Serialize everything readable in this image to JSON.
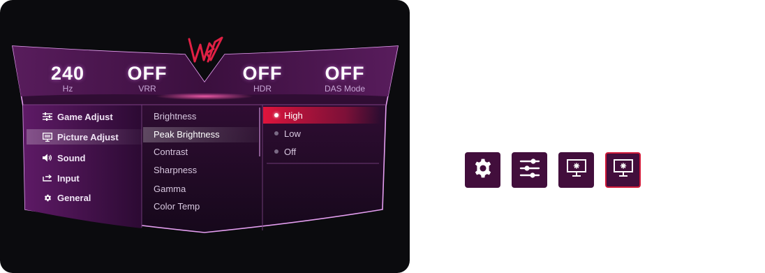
{
  "status": [
    {
      "value": "240",
      "label": "Hz"
    },
    {
      "value": "OFF",
      "label": "VRR"
    },
    {
      "value": "OFF",
      "label": "HDR"
    },
    {
      "value": "OFF",
      "label": "DAS Mode"
    }
  ],
  "main_menu": {
    "items": [
      {
        "label": "Game Adjust",
        "icon": "sliders-icon"
      },
      {
        "label": "Picture Adjust",
        "icon": "monitor-icon"
      },
      {
        "label": "Sound",
        "icon": "speaker-icon"
      },
      {
        "label": "Input",
        "icon": "input-icon"
      },
      {
        "label": "General",
        "icon": "gear-icon"
      }
    ],
    "selected": "Picture Adjust"
  },
  "submenu": {
    "items": [
      "Brightness",
      "Peak Brightness",
      "Contrast",
      "Sharpness",
      "Gamma",
      "Color Temp"
    ],
    "active": "Peak Brightness"
  },
  "options": {
    "items": [
      "High",
      "Low",
      "Off"
    ],
    "selected": "High"
  },
  "icon_buttons": [
    {
      "icon": "gear-icon"
    },
    {
      "icon": "sliders-icon"
    },
    {
      "icon": "monitor-brightness-icon"
    },
    {
      "icon": "monitor-brightness-icon",
      "selected": true
    }
  ],
  "colors": {
    "accent_red": "#d11a3a",
    "panel_purple": "#420e3c",
    "osd_background": "#0b0b0e"
  }
}
